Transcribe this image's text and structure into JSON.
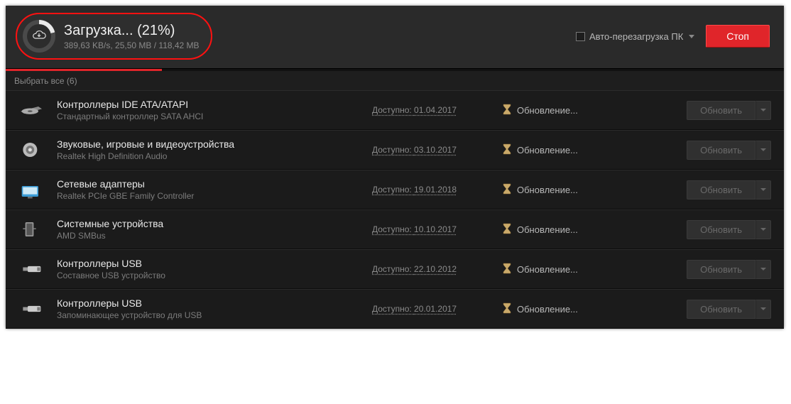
{
  "header": {
    "title": "Загрузка... (21%)",
    "sub": "389,63 KB/s, 25,50 MB / 118,42 MB",
    "auto_restart_label": "Авто-перезагрузка ПК",
    "stop_label": "Стоп"
  },
  "select_all": "Выбрать все (6)",
  "available_prefix": "Доступно: ",
  "status_updating": "Обновление...",
  "update_button_label": "Обновить",
  "rows": [
    {
      "title": "Контроллеры IDE ATA/ATAPI",
      "desc": "Стандартный контроллер SATA AHCI",
      "date": "01.04.2017",
      "icon": "ide"
    },
    {
      "title": "Звуковые, игровые и видеоустройства",
      "desc": "Realtek High Definition Audio",
      "date": "03.10.2017",
      "icon": "audio"
    },
    {
      "title": "Сетевые адаптеры",
      "desc": "Realtek PCIe GBE Family Controller",
      "date": "19.01.2018",
      "icon": "network"
    },
    {
      "title": "Системные устройства",
      "desc": "AMD SMBus",
      "date": "10.10.2017",
      "icon": "system"
    },
    {
      "title": "Контроллеры USB",
      "desc": "Составное USB устройство",
      "date": "22.10.2012",
      "icon": "usb"
    },
    {
      "title": "Контроллеры USB",
      "desc": "Запоминающее устройство для USB",
      "date": "20.01.2017",
      "icon": "usb"
    }
  ]
}
